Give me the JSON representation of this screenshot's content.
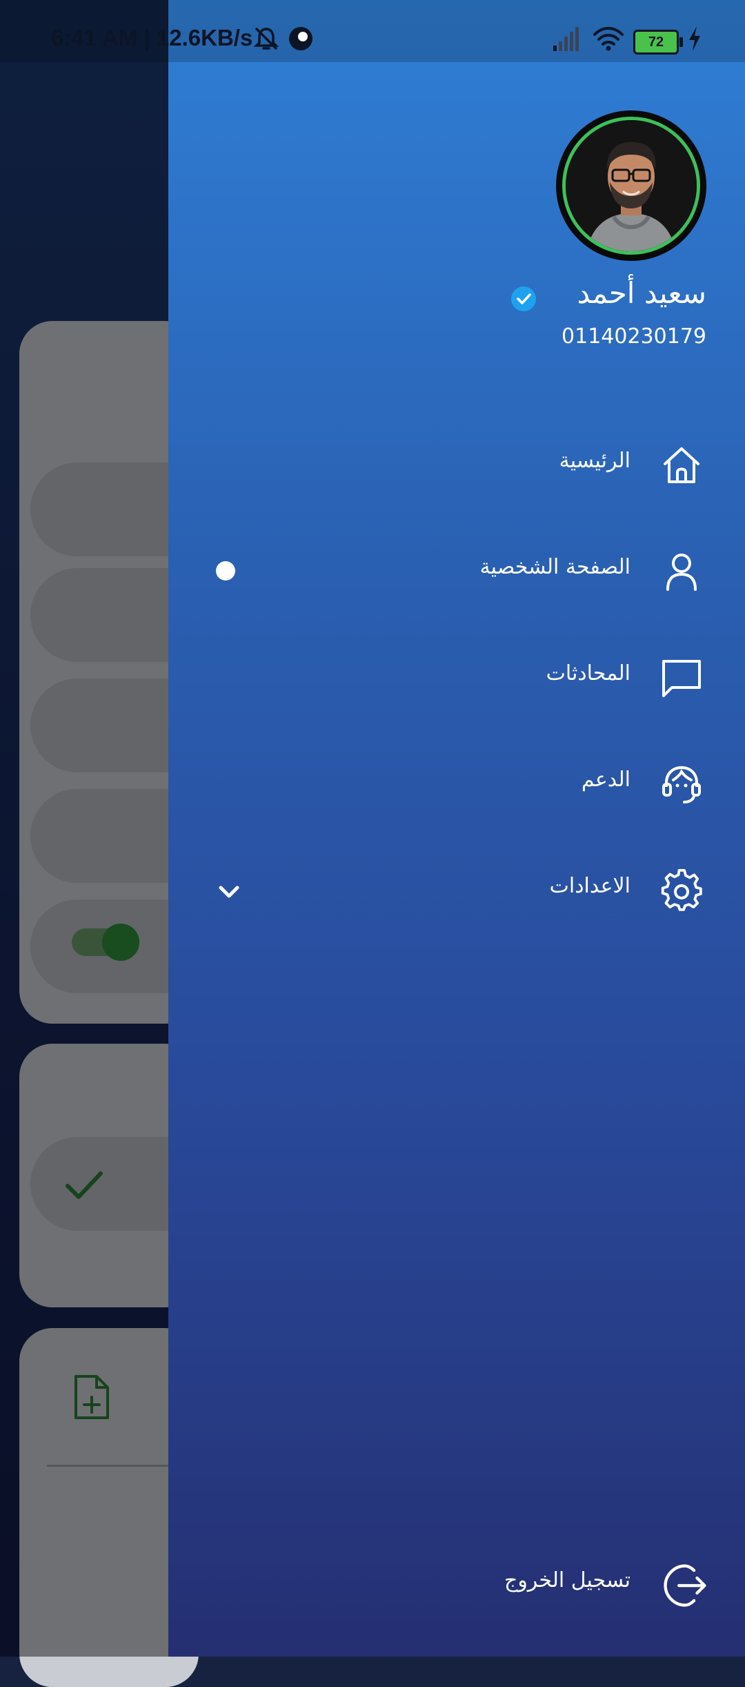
{
  "status_bar": {
    "time_and_speed": "6:41 AM | 12.6KB/s",
    "battery_level": "72"
  },
  "drawer": {
    "user": {
      "name": "سعيد أحمد",
      "phone": "01140230179"
    },
    "menu": [
      {
        "label": "الرئيسية",
        "icon": "home-icon"
      },
      {
        "label": "الصفحة الشخصية",
        "icon": "user-icon"
      },
      {
        "label": "المحادثات",
        "icon": "chat-icon"
      },
      {
        "label": "الدعم",
        "icon": "support-icon"
      },
      {
        "label": "الاعدادات",
        "icon": "settings-icon"
      }
    ],
    "logout_label": "تسجيل الخروج"
  },
  "colors": {
    "drawer_top": "#2f7fd6",
    "drawer_bottom": "#252f72",
    "avatar_ring": "#3cc15b",
    "verified_badge": "#1ea2f0"
  }
}
